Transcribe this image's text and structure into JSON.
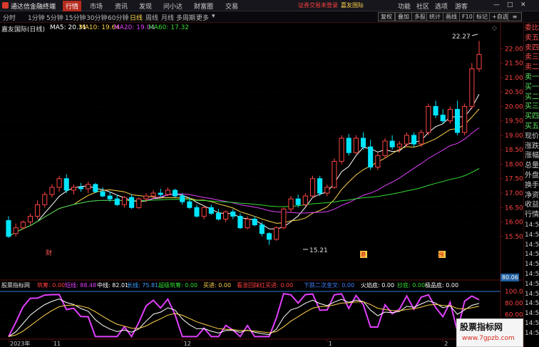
{
  "titlebar": {
    "app_title": "通达信金融终端",
    "menus": [
      "行情",
      "市场",
      "资讯",
      "发现",
      "问小达",
      "财富圈",
      "交易"
    ],
    "active_menu": "行情",
    "notice_login": "证券交易未登录",
    "notice_account": "嘉友国际",
    "window_buttons": [
      "功能",
      "社区",
      "选项",
      "游客"
    ]
  },
  "toolbar": {
    "periods": [
      "分时",
      "1分钟",
      "5分钟",
      "15分钟",
      "30分钟",
      "60分钟",
      "日线",
      "周线",
      "月线",
      "多周期",
      "更多"
    ],
    "active_period": "日线",
    "tools": [
      "复权",
      "叠加",
      "多股",
      "统计",
      "画线",
      "F10",
      "标记",
      "+自选"
    ]
  },
  "stock": {
    "name": "嘉友国际(日线)"
  },
  "ma_labels": [
    {
      "text": "MA5: 20.31",
      "color": "#ffffff"
    },
    {
      "text": "MA10: 19.64",
      "color": "#ffd24a"
    },
    {
      "text": "MA20: 19.04",
      "color": "#e040fb"
    },
    {
      "text": "MA60: 17.32",
      "color": "#33dd33"
    }
  ],
  "price_axis": [
    "22.00",
    "21.50",
    "21.00",
    "20.50",
    "20.00",
    "19.50",
    "19.00",
    "18.50",
    "18.00",
    "17.50",
    "17.00",
    "16.50",
    "16.00",
    "15.50"
  ],
  "price_annotations": {
    "high": "22.27",
    "low": "15.21"
  },
  "event_markers": [
    "财",
    "港",
    "预"
  ],
  "indicator_bar": [
    {
      "text": "股票指标网",
      "color": "#e0e0e0"
    },
    {
      "text": "筑筹: 0.00",
      "color": "#ff4040"
    },
    {
      "text": "短线: 88.48",
      "color": "#e040fb"
    },
    {
      "text": "中线: 82.01",
      "color": "#ffffff"
    },
    {
      "text": "长线: 75.81",
      "color": "#40a0ff"
    },
    {
      "text": "超级筑筹: 0.00",
      "color": "#33dd33"
    },
    {
      "text": "买进: 0.00",
      "color": "#ffd24a"
    },
    {
      "text": "看涨回踩红买进: 0.00",
      "color": "#ff4040"
    },
    {
      "text": "下跌二次金叉: 0.00",
      "color": "#4080ff"
    },
    {
      "text": "火焰底: 0.00",
      "color": "#ffffff"
    },
    {
      "text": "抄底: 0.00",
      "color": "#33dd33"
    },
    {
      "text": "极品底: 0.00",
      "color": "#ffffff"
    }
  ],
  "ind_axis": [
    "100.00",
    "80.00",
    "60.00",
    "40.00",
    "20.00"
  ],
  "ind_current": "80.06",
  "date_axis": [
    "2023年",
    "11",
    "12",
    "1",
    "2"
  ],
  "side_panel": [
    "委比",
    "卖五",
    "卖四",
    "卖三",
    "卖二",
    "卖一",
    "买一",
    "买二",
    "买三",
    "买四",
    "买五",
    "现价",
    "涨跌",
    "涨幅",
    "总量",
    "外盘",
    "换手",
    "净资",
    "收益",
    "行情",
    "14:50",
    "14:50",
    "14:50",
    "14:50",
    "14:50",
    "14:50",
    "14:50",
    "14:50",
    "14:50",
    "14:50",
    "14:50",
    "14:50"
  ],
  "watermark": {
    "title": "股票指标网",
    "url": "www.7gpzb.com"
  },
  "colors": {
    "up": "#ff4444",
    "down": "#00e5ff",
    "ma5": "#ffffff",
    "ma10": "#ffd24a",
    "ma20": "#e040fb",
    "ma60": "#33dd33",
    "accent": "#b72a1e"
  },
  "chart_data": {
    "type": "candlestick",
    "ylim": [
      15.2,
      22.5
    ],
    "candles": [
      [
        16.05,
        16.2,
        15.45,
        15.5
      ],
      [
        15.6,
        15.95,
        15.5,
        15.8
      ],
      [
        15.8,
        16.05,
        15.75,
        16.0
      ],
      [
        16.0,
        16.3,
        15.9,
        16.2
      ],
      [
        16.2,
        16.75,
        16.1,
        16.6
      ],
      [
        16.6,
        17.05,
        16.5,
        16.95
      ],
      [
        16.95,
        17.3,
        16.85,
        17.2
      ],
      [
        17.2,
        17.6,
        17.05,
        17.5
      ],
      [
        17.5,
        17.65,
        17.0,
        17.1
      ],
      [
        17.1,
        17.3,
        16.95,
        17.2
      ],
      [
        17.2,
        17.35,
        17.05,
        17.15
      ],
      [
        17.15,
        17.4,
        17.0,
        17.3
      ],
      [
        17.3,
        17.35,
        17.0,
        17.05
      ],
      [
        17.05,
        17.2,
        16.85,
        16.9
      ],
      [
        16.9,
        17.05,
        16.7,
        16.8
      ],
      [
        16.8,
        16.95,
        16.55,
        16.6
      ],
      [
        16.6,
        16.9,
        16.5,
        16.85
      ],
      [
        16.85,
        16.95,
        16.45,
        16.5
      ],
      [
        16.5,
        16.85,
        16.45,
        16.8
      ],
      [
        16.8,
        17.0,
        16.7,
        16.9
      ],
      [
        16.9,
        17.1,
        16.8,
        17.0
      ],
      [
        17.0,
        17.15,
        16.85,
        16.95
      ],
      [
        16.95,
        17.2,
        16.9,
        17.1
      ],
      [
        17.1,
        17.15,
        16.85,
        16.9
      ],
      [
        16.9,
        17.0,
        16.6,
        16.7
      ],
      [
        16.7,
        16.85,
        16.45,
        16.5
      ],
      [
        16.5,
        16.6,
        16.15,
        16.2
      ],
      [
        16.2,
        16.55,
        16.1,
        16.5
      ],
      [
        16.5,
        16.6,
        16.25,
        16.3
      ],
      [
        16.3,
        16.45,
        16.05,
        16.1
      ],
      [
        16.1,
        16.4,
        16.0,
        16.35
      ],
      [
        16.35,
        16.45,
        16.1,
        16.2
      ],
      [
        16.2,
        16.3,
        15.75,
        15.8
      ],
      [
        15.8,
        16.2,
        15.75,
        16.1
      ],
      [
        16.1,
        16.2,
        15.85,
        15.9
      ],
      [
        15.9,
        16.0,
        15.5,
        15.6
      ],
      [
        15.6,
        15.65,
        15.21,
        15.4
      ],
      [
        15.4,
        15.85,
        15.35,
        15.8
      ],
      [
        15.8,
        16.5,
        15.75,
        16.45
      ],
      [
        16.45,
        16.9,
        16.35,
        16.8
      ],
      [
        16.8,
        16.95,
        16.5,
        16.6
      ],
      [
        16.6,
        17.0,
        16.55,
        16.9
      ],
      [
        16.9,
        17.6,
        16.85,
        17.5
      ],
      [
        17.5,
        17.6,
        16.9,
        17.0
      ],
      [
        17.0,
        17.3,
        16.9,
        17.2
      ],
      [
        17.2,
        18.2,
        17.15,
        18.1
      ],
      [
        18.1,
        19.0,
        18.0,
        18.9
      ],
      [
        18.9,
        19.05,
        18.3,
        18.4
      ],
      [
        18.4,
        19.0,
        18.35,
        18.9
      ],
      [
        18.9,
        19.1,
        18.5,
        18.6
      ],
      [
        18.6,
        18.85,
        17.8,
        17.9
      ],
      [
        17.9,
        18.4,
        17.8,
        18.3
      ],
      [
        18.3,
        18.9,
        18.2,
        18.8
      ],
      [
        18.8,
        19.0,
        18.5,
        18.6
      ],
      [
        18.6,
        18.8,
        18.4,
        18.7
      ],
      [
        18.7,
        19.1,
        18.6,
        19.0
      ],
      [
        19.0,
        19.1,
        18.6,
        18.7
      ],
      [
        18.7,
        19.2,
        18.6,
        19.1
      ],
      [
        19.1,
        20.1,
        19.0,
        20.0
      ],
      [
        20.0,
        20.2,
        19.6,
        19.7
      ],
      [
        19.7,
        19.9,
        19.4,
        19.5
      ],
      [
        19.5,
        20.0,
        19.4,
        19.9
      ],
      [
        19.9,
        20.2,
        19.0,
        19.1
      ],
      [
        19.1,
        20.1,
        19.0,
        20.0
      ],
      [
        20.0,
        21.5,
        19.9,
        21.3
      ],
      [
        21.3,
        22.27,
        21.2,
        21.8
      ]
    ]
  }
}
